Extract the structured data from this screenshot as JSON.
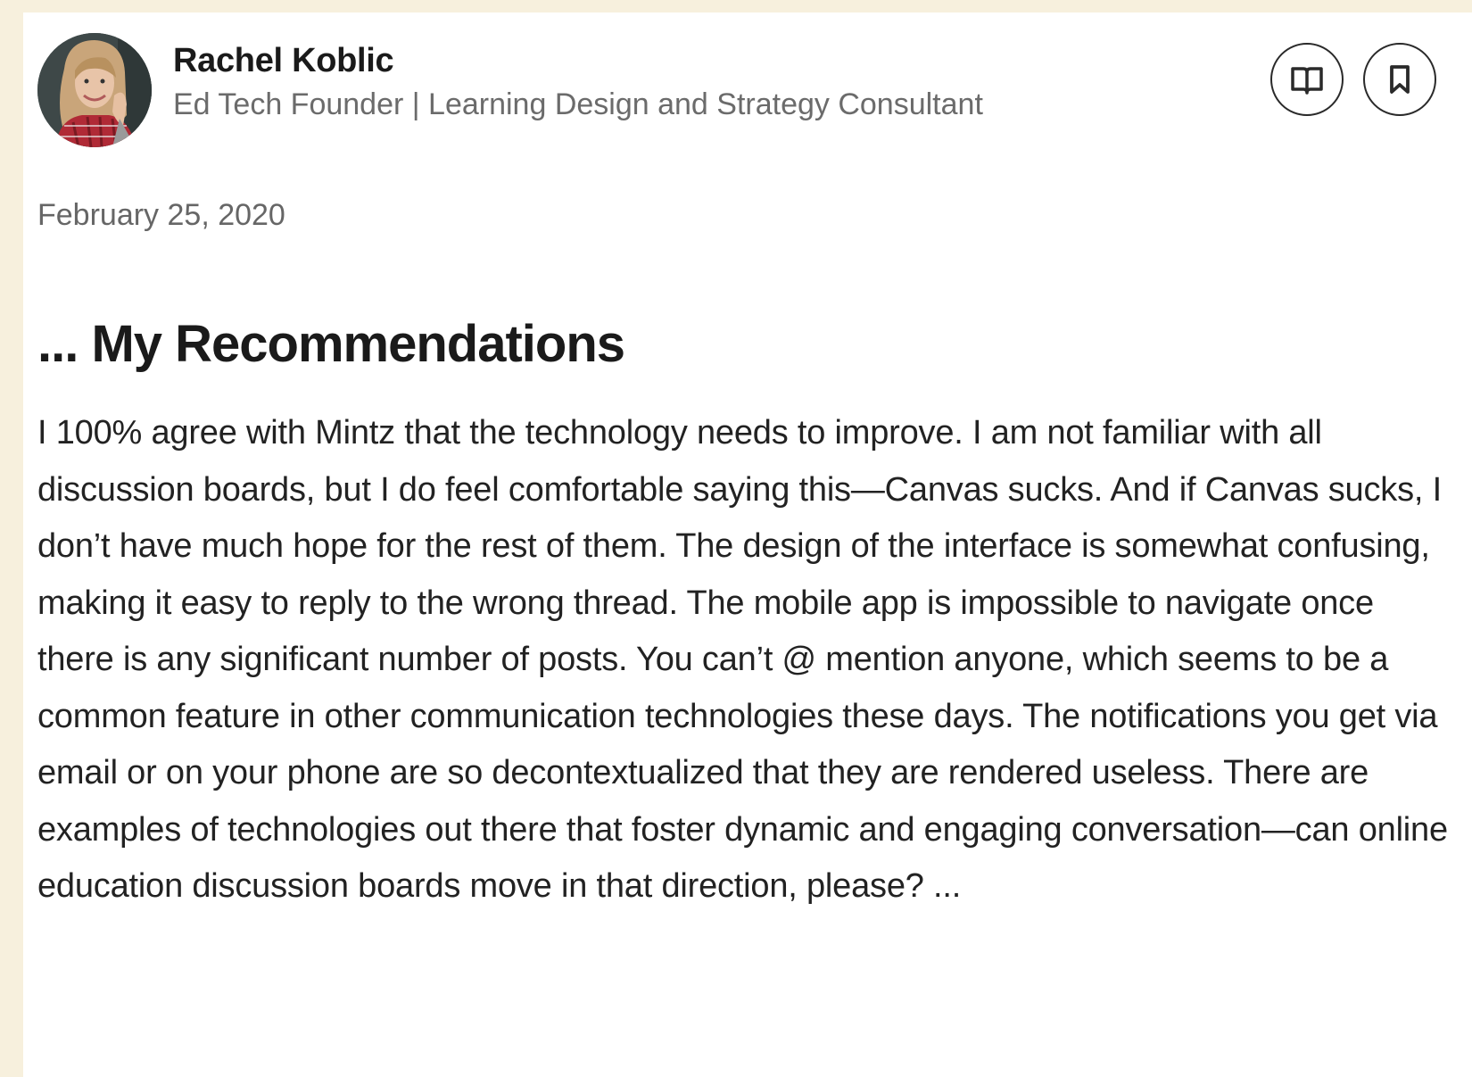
{
  "post": {
    "author": {
      "name": "Rachel Koblic",
      "headline": "Ed Tech Founder | Learning Design and Strategy Consultant"
    },
    "actions": [
      {
        "icon": "book-open-icon"
      },
      {
        "icon": "bookmark-icon"
      }
    ],
    "date": "February 25, 2020",
    "title": "... My Recommendations",
    "body": "I 100% agree with Mintz that the technology needs to improve. I am not familiar with all discussion boards, but I do feel comfortable saying this—Canvas sucks. And if Canvas sucks, I don’t have much hope for the rest of them. The design of the interface is somewhat confusing, making it easy to reply to the wrong thread. The mobile app is impossible to navigate once there is any significant number of posts. You can’t @ mention anyone, which seems to be a common feature in other communication technologies these days. The notifications you get via email or on your phone are so decontextualized that they are rendered useless. There are examples of technologies out there that foster dynamic and engaging conversation—can online education discussion boards move in that direction, please? ..."
  },
  "colors": {
    "page_background": "#f7f0dd",
    "card_background": "#ffffff",
    "headline_gray": "#6b6b6b",
    "text_dark": "#1a1a1a"
  }
}
